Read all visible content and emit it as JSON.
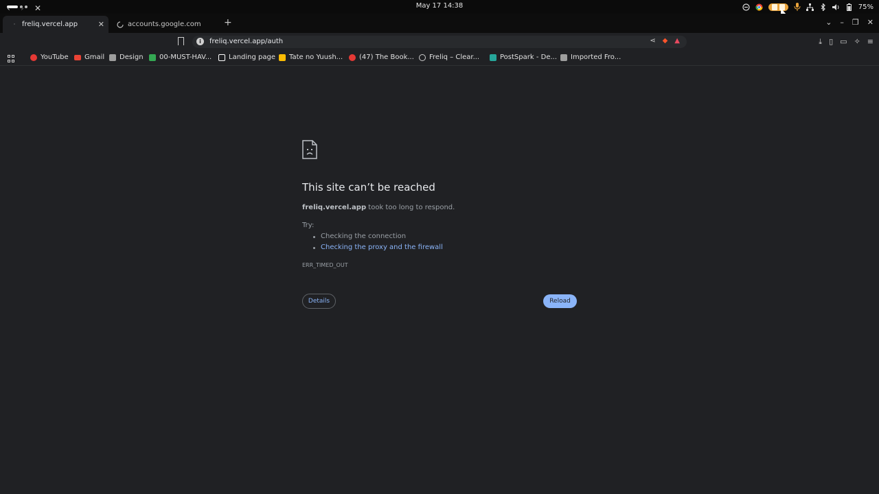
{
  "system": {
    "clock": "May 17  14:38",
    "battery": "75%"
  },
  "tabs": [
    {
      "title": "freliq.vercel.app",
      "active": true
    },
    {
      "title": "accounts.google.com",
      "active": false
    }
  ],
  "new_tab_label": "+",
  "address_bar": {
    "url": "freliq.vercel.app/auth"
  },
  "bookmarks": [
    {
      "label": "YouTube",
      "icon": "youtube-icon",
      "color": "#e53935"
    },
    {
      "label": "Gmail",
      "icon": "gmail-icon",
      "color": "#ea4335"
    },
    {
      "label": "Design",
      "icon": "folder-icon",
      "color": "#9e9e9e"
    },
    {
      "label": "00-MUST-HAV...",
      "icon": "drive-icon",
      "color": "#34a853"
    },
    {
      "label": "Landing page",
      "icon": "notion-icon",
      "color": "#ffffff"
    },
    {
      "label": "Tate no Yuush...",
      "icon": "drive-icon",
      "color": "#fbbc04"
    },
    {
      "label": "(47) The Book...",
      "icon": "youtube-icon",
      "color": "#e53935"
    },
    {
      "label": "Freliq – Clear...",
      "icon": "globe-icon",
      "color": "#cfcfcf"
    },
    {
      "label": "PostSpark - De...",
      "icon": "postspark-icon",
      "color": "#26a69a"
    },
    {
      "label": "Imported Fro...",
      "icon": "folder-icon",
      "color": "#9e9e9e"
    }
  ],
  "error": {
    "title": "This site can’t be reached",
    "host": "freliq.vercel.app",
    "message": " took too long to respond.",
    "try_label": "Try:",
    "suggestions": [
      {
        "text": "Checking the connection",
        "link": false
      },
      {
        "text": "Checking the proxy and the firewall",
        "link": true
      }
    ],
    "code": "ERR_TIMED_OUT",
    "details_button": "Details",
    "reload_button": "Reload"
  },
  "colors": {
    "page_bg": "#202124",
    "link": "#8ab4f8",
    "reload_bg": "#8ab4f8",
    "tray_highlight": "#e9a33a"
  }
}
